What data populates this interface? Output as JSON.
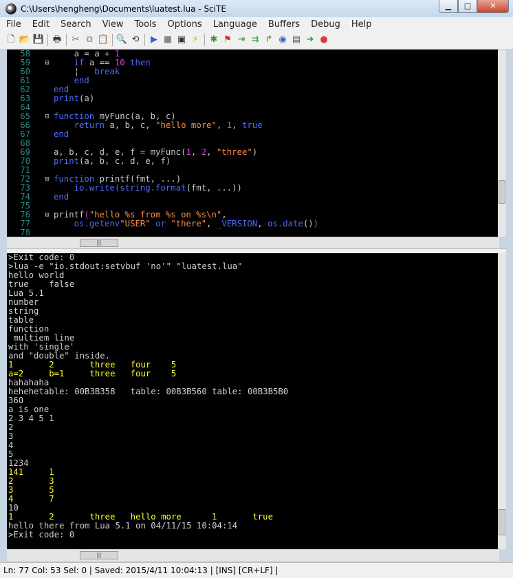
{
  "window": {
    "title": "C:\\Users\\hengheng\\Documents\\luatest.lua - SciTE"
  },
  "menu": [
    "File",
    "Edit",
    "Search",
    "View",
    "Tools",
    "Options",
    "Language",
    "Buffers",
    "Debug",
    "Help"
  ],
  "toolbar": [
    {
      "name": "new-file-icon",
      "glyph": "🗋",
      "color": "#333"
    },
    {
      "name": "open-file-icon",
      "glyph": "📂",
      "color": "#c9a23c"
    },
    {
      "name": "save-file-icon",
      "glyph": "💾",
      "color": "#333"
    },
    {
      "sep": true
    },
    {
      "name": "print-icon",
      "glyph": "🖶",
      "color": "#333"
    },
    {
      "sep": true
    },
    {
      "name": "cut-icon",
      "glyph": "✂",
      "color": "#777"
    },
    {
      "name": "copy-icon",
      "glyph": "⧉",
      "color": "#777"
    },
    {
      "name": "paste-icon",
      "glyph": "📋",
      "color": "#777"
    },
    {
      "sep": true
    },
    {
      "name": "find-icon",
      "glyph": "🔍",
      "color": "#333"
    },
    {
      "name": "replace-icon",
      "glyph": "⟲",
      "color": "#333"
    },
    {
      "sep": true
    },
    {
      "name": "go-icon",
      "glyph": "▶",
      "color": "#3a62c8"
    },
    {
      "name": "stop-icon",
      "glyph": "■",
      "color": "#888"
    },
    {
      "name": "console-icon",
      "glyph": "▣",
      "color": "#333"
    },
    {
      "name": "compile-icon",
      "glyph": "⚡",
      "color": "#d8a400"
    },
    {
      "sep": true
    },
    {
      "name": "debug-bug-icon",
      "glyph": "✱",
      "color": "#2e9a2e"
    },
    {
      "name": "debug-break-icon",
      "glyph": "⚑",
      "color": "#d03030"
    },
    {
      "name": "step-into-icon",
      "glyph": "⇥",
      "color": "#2e9a2e"
    },
    {
      "name": "step-over-icon",
      "glyph": "⇉",
      "color": "#2e9a2e"
    },
    {
      "name": "step-out-icon",
      "glyph": "↱",
      "color": "#2e9a2e"
    },
    {
      "name": "watch-icon",
      "glyph": "◉",
      "color": "#3a62c8"
    },
    {
      "name": "locals-icon",
      "glyph": "▤",
      "color": "#555"
    },
    {
      "name": "run-to-cursor-icon",
      "glyph": "➜",
      "color": "#2e9a2e"
    },
    {
      "name": "kill-icon",
      "glyph": "●",
      "color": "#e03a3a"
    }
  ],
  "editor": {
    "lines": [
      {
        "n": "58",
        "fold": "",
        "segs": [
          {
            "t": "    a = a + ",
            "c": "plain"
          },
          {
            "t": "1",
            "c": "num"
          }
        ]
      },
      {
        "n": "59",
        "fold": "⊟",
        "segs": [
          {
            "t": "    ",
            "c": "plain"
          },
          {
            "t": "if",
            "c": "kw"
          },
          {
            "t": " a == ",
            "c": "plain"
          },
          {
            "t": "10",
            "c": "num"
          },
          {
            "t": " ",
            "c": "plain"
          },
          {
            "t": "then",
            "c": "kw"
          }
        ]
      },
      {
        "n": "60",
        "fold": "",
        "segs": [
          {
            "t": "    ¦   ",
            "c": "plain"
          },
          {
            "t": "break",
            "c": "kw"
          }
        ]
      },
      {
        "n": "61",
        "fold": "",
        "segs": [
          {
            "t": "    ",
            "c": "plain"
          },
          {
            "t": "end",
            "c": "kw"
          }
        ]
      },
      {
        "n": "62",
        "fold": "",
        "segs": [
          {
            "t": "end",
            "c": "kw"
          }
        ]
      },
      {
        "n": "63",
        "fold": "",
        "segs": [
          {
            "t": "print",
            "c": "kw"
          },
          {
            "t": "(a)",
            "c": "plain"
          }
        ]
      },
      {
        "n": "64",
        "fold": "",
        "segs": []
      },
      {
        "n": "65",
        "fold": "⊟",
        "segs": [
          {
            "t": "function",
            "c": "kw"
          },
          {
            "t": " myFunc(a, b, c)",
            "c": "plain"
          }
        ]
      },
      {
        "n": "66",
        "fold": "",
        "segs": [
          {
            "t": "    ",
            "c": "plain"
          },
          {
            "t": "return",
            "c": "kw"
          },
          {
            "t": " a, b, c, ",
            "c": "plain"
          },
          {
            "t": "\"hello more\"",
            "c": "str"
          },
          {
            "t": ", ",
            "c": "plain"
          },
          {
            "t": "1",
            "c": "num"
          },
          {
            "t": ", ",
            "c": "plain"
          },
          {
            "t": "true",
            "c": "kw"
          }
        ]
      },
      {
        "n": "67",
        "fold": "",
        "segs": [
          {
            "t": "end",
            "c": "kw"
          }
        ]
      },
      {
        "n": "68",
        "fold": "",
        "segs": []
      },
      {
        "n": "69",
        "fold": "",
        "segs": [
          {
            "t": "a, b, c, d, e, f = myFunc(",
            "c": "plain"
          },
          {
            "t": "1",
            "c": "num"
          },
          {
            "t": ", ",
            "c": "plain"
          },
          {
            "t": "2",
            "c": "num"
          },
          {
            "t": ", ",
            "c": "plain"
          },
          {
            "t": "\"three\"",
            "c": "str"
          },
          {
            "t": ")",
            "c": "plain"
          }
        ]
      },
      {
        "n": "70",
        "fold": "",
        "segs": [
          {
            "t": "print",
            "c": "kw"
          },
          {
            "t": "(a, b, c, d, e, f)",
            "c": "plain"
          }
        ]
      },
      {
        "n": "71",
        "fold": "",
        "segs": []
      },
      {
        "n": "72",
        "fold": "⊟",
        "segs": [
          {
            "t": "function",
            "c": "kw"
          },
          {
            "t": " printf(fmt, ...)",
            "c": "plain"
          }
        ]
      },
      {
        "n": "73",
        "fold": "",
        "segs": [
          {
            "t": "    ",
            "c": "plain"
          },
          {
            "t": "io.write(string.format",
            "c": "kw"
          },
          {
            "t": "(fmt, ...))",
            "c": "plain"
          }
        ]
      },
      {
        "n": "74",
        "fold": "",
        "segs": [
          {
            "t": "end",
            "c": "kw"
          }
        ]
      },
      {
        "n": "75",
        "fold": "",
        "segs": []
      },
      {
        "n": "76",
        "fold": "⊟",
        "segs": [
          {
            "t": "printf",
            "c": "plain"
          },
          {
            "t": "(",
            "c": "num"
          },
          {
            "t": "\"hello %s from %s on %s\\n\"",
            "c": "str"
          },
          {
            "t": ",",
            "c": "plain"
          }
        ]
      },
      {
        "n": "77",
        "fold": "",
        "segs": [
          {
            "t": "    ",
            "c": "plain"
          },
          {
            "t": "os.getenv",
            "c": "kw"
          },
          {
            "t": "\"USER\"",
            "c": "str"
          },
          {
            "t": " ",
            "c": "plain"
          },
          {
            "t": "or",
            "c": "kw"
          },
          {
            "t": " ",
            "c": "plain"
          },
          {
            "t": "\"there\"",
            "c": "str"
          },
          {
            "t": ", ",
            "c": "plain"
          },
          {
            "t": "_VERSION",
            "c": "kw"
          },
          {
            "t": ", ",
            "c": "plain"
          },
          {
            "t": "os.date",
            "c": "kw"
          },
          {
            "t": "()",
            "c": "plain"
          },
          {
            "t": ")",
            "c": "num"
          }
        ]
      },
      {
        "n": "78",
        "fold": "",
        "segs": []
      }
    ]
  },
  "output": {
    "lines": [
      {
        "t": ">Exit code: 0",
        "y": false
      },
      {
        "t": ">lua -e \"io.stdout:setvbuf 'no'\" \"luatest.lua\"",
        "y": false
      },
      {
        "t": "hello world",
        "y": false
      },
      {
        "t": "true    false",
        "y": false
      },
      {
        "t": "Lua 5.1",
        "y": false
      },
      {
        "t": "number",
        "y": false
      },
      {
        "t": "string",
        "y": false
      },
      {
        "t": "table",
        "y": false
      },
      {
        "t": "function",
        "y": false
      },
      {
        "t": " multiem line",
        "y": false
      },
      {
        "t": "with 'single'",
        "y": false
      },
      {
        "t": "and \"double\" inside.",
        "y": false
      },
      {
        "t": "1       2       three   four    5",
        "y": true
      },
      {
        "t": "a=2     b=1     three   four    5",
        "y": true
      },
      {
        "t": "hahahaha",
        "y": false
      },
      {
        "t": "hehehetable: 00B3B358   table: 00B3B560 table: 00B3B5B0",
        "y": false
      },
      {
        "t": "360",
        "y": false
      },
      {
        "t": "a is one",
        "y": false
      },
      {
        "t": "2 3 4 5 1",
        "y": false
      },
      {
        "t": "2",
        "y": false
      },
      {
        "t": "3",
        "y": false
      },
      {
        "t": "4",
        "y": false
      },
      {
        "t": "5",
        "y": false
      },
      {
        "t": "1234",
        "y": false
      },
      {
        "t": "141     1",
        "y": true
      },
      {
        "t": "2       3",
        "y": true
      },
      {
        "t": "3       5",
        "y": true
      },
      {
        "t": "4       7",
        "y": true
      },
      {
        "t": "10",
        "y": false
      },
      {
        "t": "1       2       three   hello more      1       true",
        "y": true
      },
      {
        "t": "hello there from Lua 5.1 on 04/11/15 10:04:14",
        "y": false
      },
      {
        "t": ">Exit code: 0",
        "y": false
      }
    ]
  },
  "status": {
    "text": "Ln: 77 Col: 53 Sel: 0  |  Saved: 2015/4/11  10:04:13  |  [INS]  [CR+LF] |"
  }
}
